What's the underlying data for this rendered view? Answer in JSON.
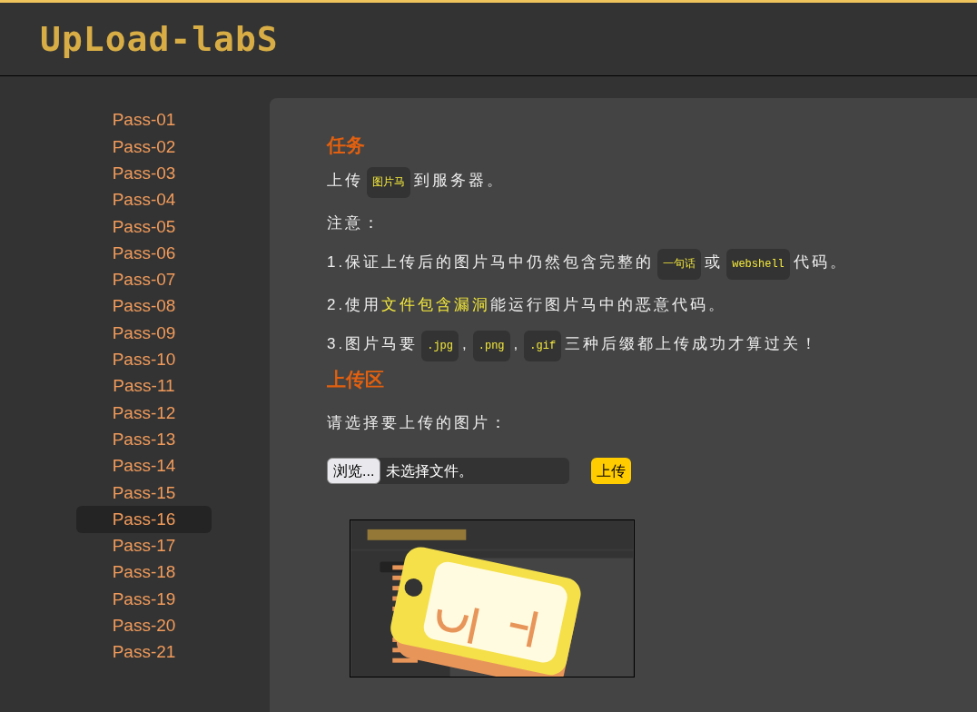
{
  "logo": "UpLoad-labS",
  "sidebar": {
    "items": [
      {
        "label": "Pass-01",
        "selected": false
      },
      {
        "label": "Pass-02",
        "selected": false
      },
      {
        "label": "Pass-03",
        "selected": false
      },
      {
        "label": "Pass-04",
        "selected": false
      },
      {
        "label": "Pass-05",
        "selected": false
      },
      {
        "label": "Pass-06",
        "selected": false
      },
      {
        "label": "Pass-07",
        "selected": false
      },
      {
        "label": "Pass-08",
        "selected": false
      },
      {
        "label": "Pass-09",
        "selected": false
      },
      {
        "label": "Pass-10",
        "selected": false
      },
      {
        "label": "Pass-11",
        "selected": false
      },
      {
        "label": "Pass-12",
        "selected": false
      },
      {
        "label": "Pass-13",
        "selected": false
      },
      {
        "label": "Pass-14",
        "selected": false
      },
      {
        "label": "Pass-15",
        "selected": false
      },
      {
        "label": "Pass-16",
        "selected": true
      },
      {
        "label": "Pass-17",
        "selected": false
      },
      {
        "label": "Pass-18",
        "selected": false
      },
      {
        "label": "Pass-19",
        "selected": false
      },
      {
        "label": "Pass-20",
        "selected": false
      },
      {
        "label": "Pass-21",
        "selected": false
      }
    ]
  },
  "task": {
    "title": "任务",
    "paragraphs": [
      [
        {
          "kind": "text",
          "text": "上传"
        },
        {
          "kind": "code",
          "text": "图片马"
        },
        {
          "kind": "text",
          "text": "到服务器。"
        }
      ],
      [
        {
          "kind": "text",
          "text": "注意："
        }
      ],
      [
        {
          "kind": "text",
          "text": "1.保证上传后的图片马中仍然包含完整的"
        },
        {
          "kind": "code",
          "text": "一句话"
        },
        {
          "kind": "text",
          "text": "或"
        },
        {
          "kind": "code",
          "text": "webshell"
        },
        {
          "kind": "text",
          "text": "代码。"
        }
      ],
      [
        {
          "kind": "text",
          "text": "2.使用"
        },
        {
          "kind": "highlight",
          "text": "文件包含漏洞"
        },
        {
          "kind": "text",
          "text": "能运行图片马中的恶意代码。"
        }
      ],
      [
        {
          "kind": "text",
          "text": "3.图片马要"
        },
        {
          "kind": "code",
          "text": ".jpg"
        },
        {
          "kind": "text",
          "text": ","
        },
        {
          "kind": "code",
          "text": ".png"
        },
        {
          "kind": "text",
          "text": ","
        },
        {
          "kind": "code",
          "text": ".gif"
        },
        {
          "kind": "text",
          "text": "三种后缀都上传成功才算过关！"
        }
      ]
    ]
  },
  "upload": {
    "title": "上传区",
    "label": "请选择要上传的图片：",
    "browse_button": "浏览...",
    "file_status": "未选择文件。",
    "submit_button": "上传"
  }
}
